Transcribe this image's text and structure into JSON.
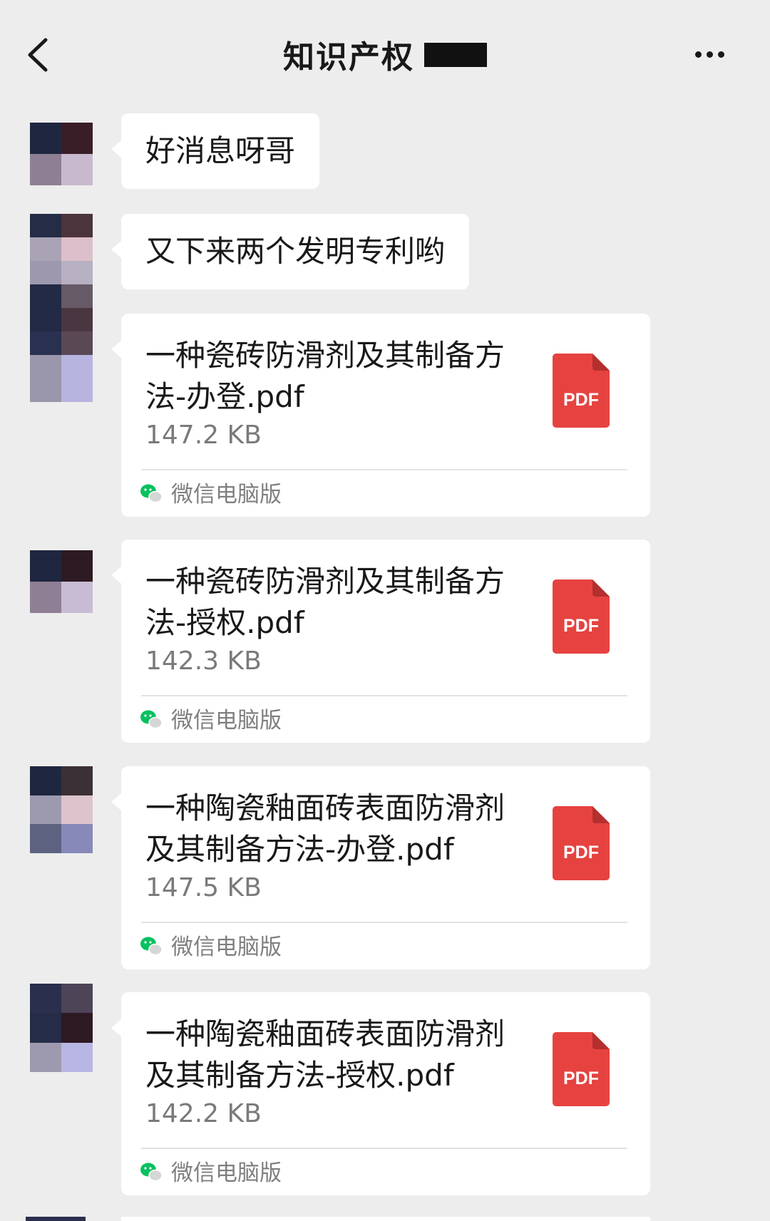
{
  "header": {
    "back_icon": "chevron-left-icon",
    "title": "知识产权",
    "more_icon": "more-dots-icon"
  },
  "messages": [
    {
      "type": "text",
      "text": "好消息呀哥"
    },
    {
      "type": "text",
      "text": "又下来两个发明专利哟"
    },
    {
      "type": "file",
      "name": "一种瓷砖防滑剂及其制备方法-办登.pdf",
      "size": "147.2 KB",
      "icon_label": "PDF",
      "source": "微信电脑版"
    },
    {
      "type": "file",
      "name": "一种瓷砖防滑剂及其制备方法-授权.pdf",
      "size": "142.3 KB",
      "icon_label": "PDF",
      "source": "微信电脑版"
    },
    {
      "type": "file",
      "name": "一种陶瓷釉面砖表面防滑剂及其制备方法-办登.pdf",
      "size": "147.5 KB",
      "icon_label": "PDF",
      "source": "微信电脑版"
    },
    {
      "type": "file",
      "name": "一种陶瓷釉面砖表面防滑剂及其制备方法-授权.pdf",
      "size": "142.2 KB",
      "icon_label": "PDF",
      "source": "微信电脑版"
    }
  ],
  "colors": {
    "background": "#ededed",
    "bubble": "#ffffff",
    "pdf_red": "#e64340",
    "wechat_green": "#07c160",
    "secondary_text": "#7f7f7f"
  }
}
